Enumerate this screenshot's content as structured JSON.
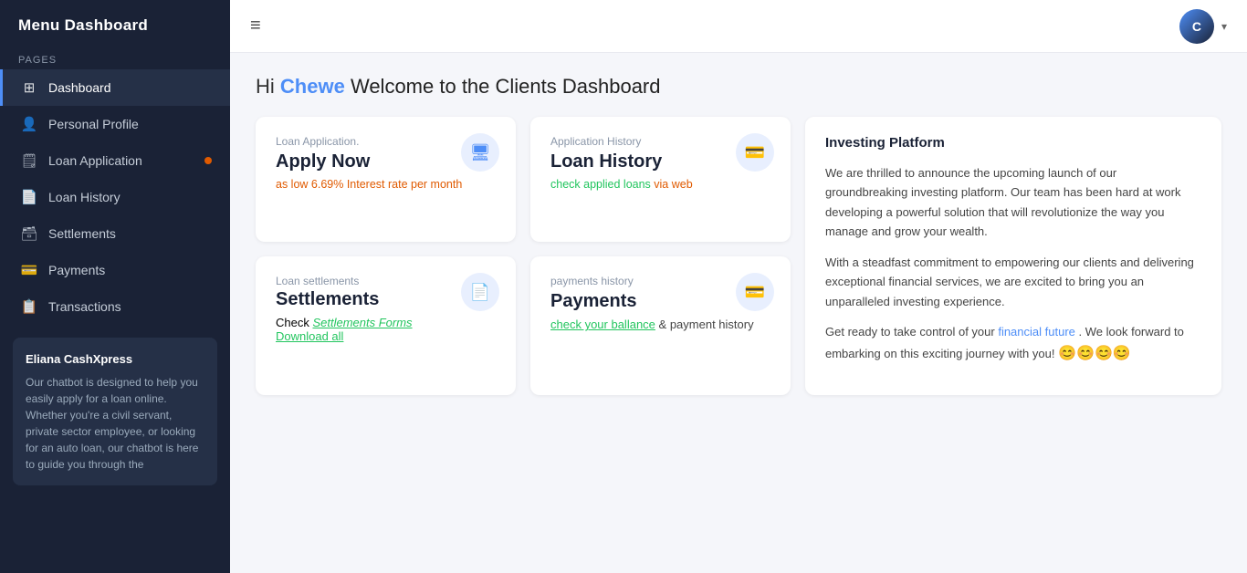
{
  "sidebar": {
    "title": "Menu Dashboard",
    "section_label": "Pages",
    "items": [
      {
        "id": "dashboard",
        "label": "Dashboard",
        "icon": "☰",
        "active": true
      },
      {
        "id": "personal-profile",
        "label": "Personal Profile",
        "icon": "👤",
        "active": false
      },
      {
        "id": "loan-application",
        "label": "Loan Application",
        "icon": "🗒",
        "active": false,
        "badge": true
      },
      {
        "id": "loan-history",
        "label": "Loan History",
        "icon": "📄",
        "active": false
      },
      {
        "id": "settlements",
        "label": "Settlements",
        "icon": "🗃",
        "active": false
      },
      {
        "id": "payments",
        "label": "Payments",
        "icon": "💳",
        "active": false
      },
      {
        "id": "transactions",
        "label": "Transactions",
        "icon": "📋",
        "active": false
      }
    ],
    "chatbot": {
      "title": "Eliana CashXpress",
      "description": "Our chatbot is designed to help you easily apply for a loan online. Whether you're a civil servant, private sector employee, or looking for an auto loan, our chatbot is here to guide you through the"
    }
  },
  "topnav": {
    "hamburger_label": "≡",
    "user_initials": "C",
    "chevron": "▾"
  },
  "main": {
    "welcome": {
      "hi": "Hi",
      "name": "Chewe",
      "rest": " Welcome to the Clients Dashboard"
    },
    "cards": {
      "loan_application": {
        "label": "Loan Application.",
        "title": "Apply Now",
        "subtitle": "as low 6.69% Interest rate per month",
        "icon": "🖥"
      },
      "application_history": {
        "label": "Application History",
        "title": "Loan History",
        "subtitle_prefix": "check applied loans",
        "subtitle_link": "check applied loans",
        "subtitle_suffix": " via web",
        "icon": "💳"
      },
      "loan_settlements": {
        "label": "Loan settlements",
        "title": "Settlements",
        "link_italic": "Settlements Forms",
        "check_prefix": "Check ",
        "download": "Download all",
        "icon": "📄"
      },
      "payments_history": {
        "label": "payments history",
        "title": "Payments",
        "link_text": "check your ballance",
        "suffix": " & payment history",
        "icon": "💳"
      },
      "investing": {
        "label": "Investing Platform",
        "para1": "We are thrilled to announce the upcoming launch of our groundbreaking investing platform. Our team has been hard at work developing a powerful solution that will revolutionize the way you manage and grow your wealth.",
        "para2": "With a steadfast commitment to empowering our clients and delivering exceptional financial services, we are excited to bring you an unparalleled investing experience.",
        "para3_prefix": "Get ready to take control of your ",
        "para3_link": "financial future",
        "para3_suffix": ". We look forward to embarking on this exciting journey with you!",
        "emojis": "😊😊😊😊"
      }
    }
  }
}
